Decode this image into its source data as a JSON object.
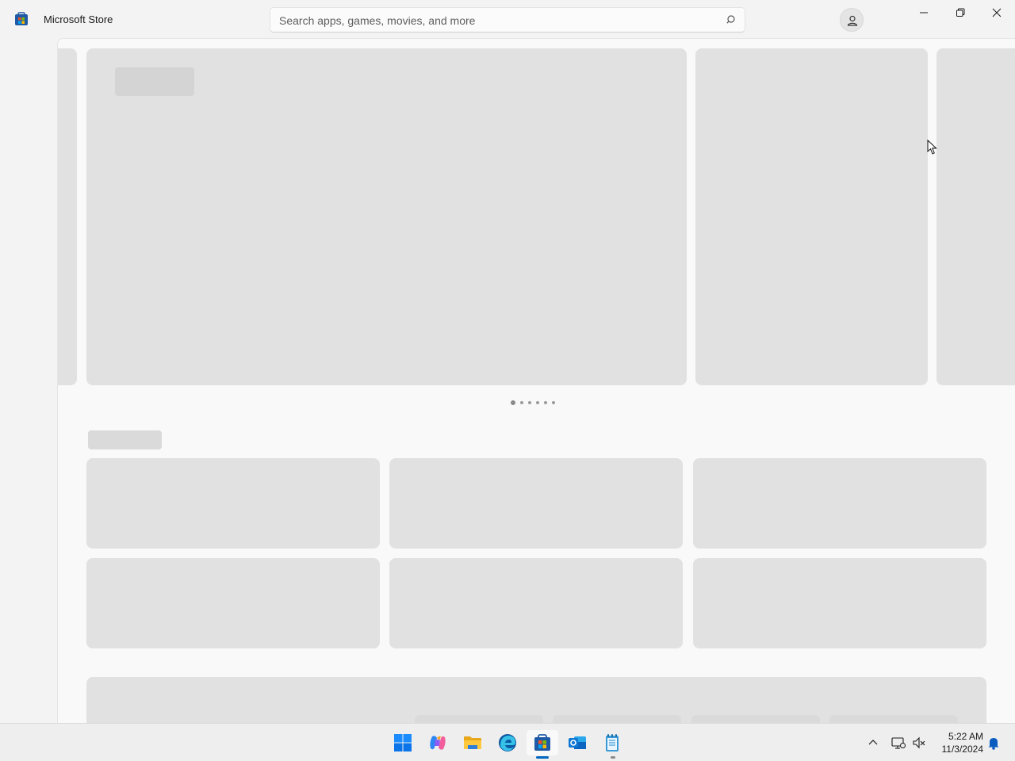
{
  "app": {
    "title": "Microsoft Store"
  },
  "search": {
    "placeholder": "Search apps, games, movies, and more"
  },
  "window_controls": {
    "minimize": "minimize",
    "maximize": "restore",
    "close": "close"
  },
  "carousel": {
    "page_count": 6,
    "active_page": 1
  },
  "taskbar": {
    "apps": [
      "start-icon",
      "copilot-icon",
      "file-explorer-icon",
      "edge-icon",
      "store-icon",
      "outlook-icon",
      "notepad-icon"
    ],
    "active_app": "store-icon"
  },
  "clock": {
    "time": "5:22 AM",
    "date": "11/3/2024"
  },
  "colors": {
    "accent": "#0067c0",
    "placeholder": "#e1e1e1",
    "background": "#f3f3f3"
  }
}
